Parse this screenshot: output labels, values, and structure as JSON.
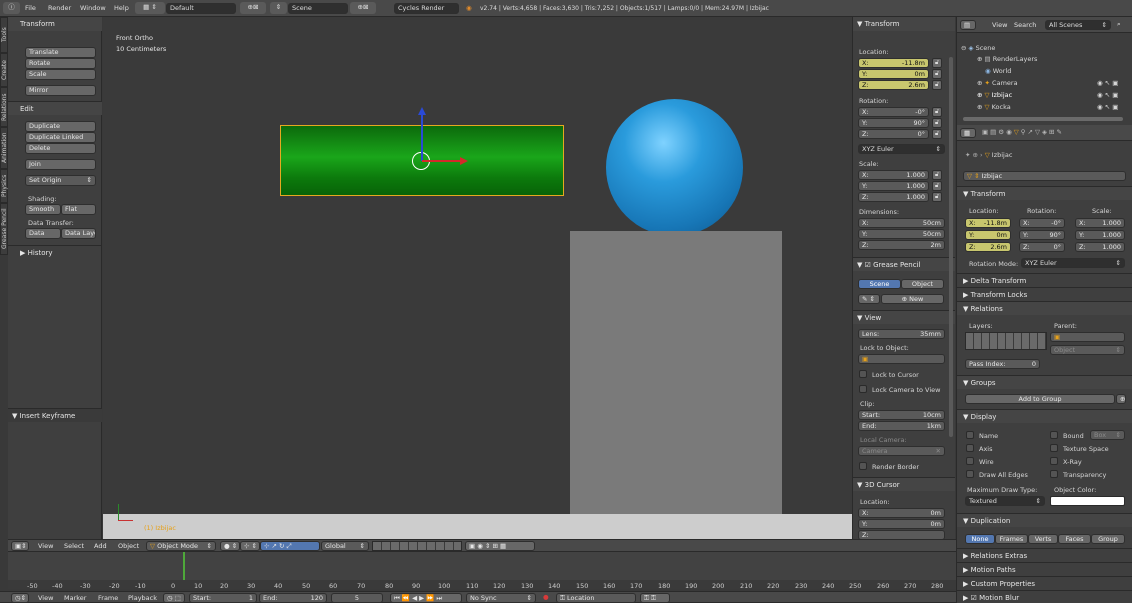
{
  "info_bar": {
    "menus": [
      "File",
      "Render",
      "Window",
      "Help"
    ],
    "layout": "Default",
    "scene": "Scene",
    "engine": "Cycles Render",
    "stats": "v2.74 | Verts:4,658 | Faces:3,630 | Tris:7,252 | Objects:1/517 | Lamps:0/0 | Mem:24.97M | Izbijac"
  },
  "toolshelf": {
    "tabs": [
      "Tools",
      "Create",
      "Relations",
      "Animation",
      "Physics",
      "Grease Pencil"
    ],
    "transform": {
      "title": "Transform",
      "buttons": [
        "Translate",
        "Rotate",
        "Scale",
        "Mirror"
      ]
    },
    "edit": {
      "title": "Edit",
      "buttons": [
        "Duplicate",
        "Duplicate Linked",
        "Delete",
        "Join"
      ],
      "set_origin": "Set Origin",
      "shading_label": "Shading:",
      "smooth": "Smooth",
      "flat": "Flat",
      "data_transfer_label": "Data Transfer:",
      "data": "Data",
      "data_layout": "Data Layo"
    },
    "history": "History",
    "insert_keyframe": "Insert Keyframe"
  },
  "viewport": {
    "view_name": "Front Ortho",
    "scale": "10 Centimeters",
    "object_label": "(1) Izbijac",
    "sphere_color": "#2a9bdc",
    "box_color": "#0a8f0a"
  },
  "viewport_header": {
    "menus": [
      "View",
      "Select",
      "Add",
      "Object"
    ],
    "mode": "Object Mode",
    "orientation": "Global"
  },
  "properties_n": {
    "transform": "Transform",
    "location_label": "Location:",
    "loc": {
      "x": "-11.8m",
      "y": "0m",
      "z": "2.6m"
    },
    "rotation_label": "Rotation:",
    "rot": {
      "x": "-0°",
      "y": "90°",
      "z": "0°"
    },
    "rotation_mode": "XYZ Euler",
    "scale_label": "Scale:",
    "scale": {
      "x": "1.000",
      "y": "1.000",
      "z": "1.000"
    },
    "dimensions_label": "Dimensions:",
    "dim": {
      "x": "50cm",
      "y": "50cm",
      "z": "2m"
    },
    "grease_pencil": "Grease Pencil",
    "gp_scene": "Scene",
    "gp_object": "Object",
    "gp_new": "New",
    "view": "View",
    "lens_label": "Lens:",
    "lens": "35mm",
    "lock_to_object": "Lock to Object:",
    "lock_to_cursor": "Lock to Cursor",
    "lock_camera": "Lock Camera to View",
    "clip_label": "Clip:",
    "clip_start_label": "Start:",
    "clip_start": "10cm",
    "clip_end_label": "End:",
    "clip_end": "1km",
    "local_camera": "Local Camera:",
    "camera": "Camera",
    "render_border": "Render Border",
    "cursor_3d": "3D Cursor",
    "cursor_location": "Location:",
    "cursor_x": "0m",
    "cursor_y": "0m"
  },
  "outliner": {
    "header_view": "View",
    "header_search": "Search",
    "header_scenes": "All Scenes",
    "items": [
      "Scene",
      "RenderLayers",
      "World",
      "Camera",
      "Izbijac",
      "Kocka"
    ]
  },
  "properties_editor": {
    "object_name": "Izbijac",
    "breadcrumb": "Izbijac",
    "transform": "Transform",
    "location": "Location:",
    "rotation": "Rotation:",
    "scale": "Scale:",
    "loc": [
      "-11.8m",
      "0m",
      "2.6m"
    ],
    "rot": [
      "-0°",
      "90°",
      "0°"
    ],
    "scl": [
      "1.000",
      "1.000",
      "1.000"
    ],
    "rotation_mode_label": "Rotation Mode:",
    "rotation_mode": "XYZ Euler",
    "delta_transform": "Delta Transform",
    "transform_locks": "Transform Locks",
    "relations": "Relations",
    "layers_label": "Layers:",
    "parent_label": "Parent:",
    "parent_type": "Object",
    "pass_index_label": "Pass Index:",
    "pass_index": "0",
    "groups": "Groups",
    "add_to_group": "Add to Group",
    "display": "Display",
    "display_items": [
      "Name",
      "Axis",
      "Wire",
      "Draw All Edges",
      "Bound",
      "Texture Space",
      "X-Ray",
      "Transparency"
    ],
    "bound_type": "Box",
    "max_draw_type_label": "Maximum Draw Type:",
    "max_draw_type": "Textured",
    "object_color_label": "Object Color:",
    "duplication": "Duplication",
    "dup_tabs": [
      "None",
      "Frames",
      "Verts",
      "Faces",
      "Group"
    ],
    "relations_extras": "Relations Extras",
    "motion_paths": "Motion Paths",
    "custom_properties": "Custom Properties",
    "motion_blur": "Motion Blur"
  },
  "timeline": {
    "ticks": [
      "-50",
      "-40",
      "-30",
      "-20",
      "-10",
      "0",
      "10",
      "20",
      "30",
      "40",
      "50",
      "60",
      "70",
      "80",
      "90",
      "100",
      "110",
      "120",
      "130",
      "140",
      "150",
      "160",
      "170",
      "180",
      "190",
      "200",
      "210",
      "220",
      "230",
      "240",
      "250",
      "260",
      "270",
      "280"
    ],
    "menus": [
      "View",
      "Marker",
      "Frame",
      "Playback"
    ],
    "start_label": "Start:",
    "start": "1",
    "end_label": "End:",
    "end": "120",
    "current": "5",
    "sync": "No Sync",
    "keying": "Location"
  }
}
